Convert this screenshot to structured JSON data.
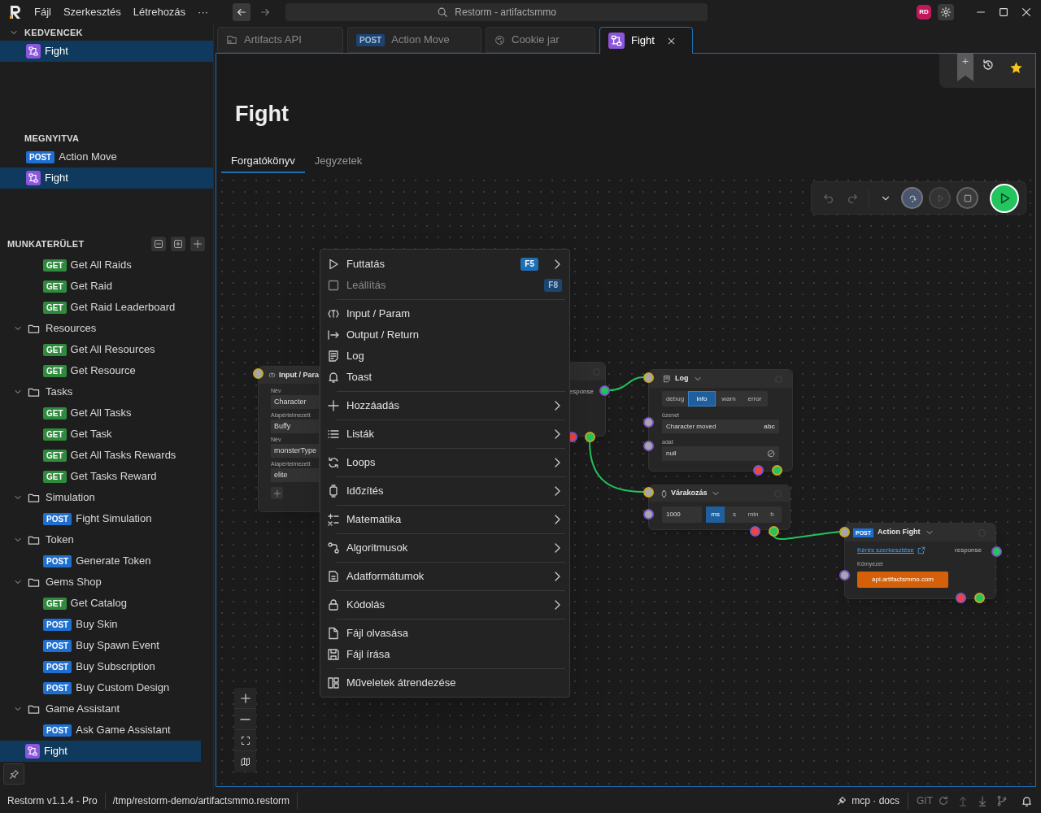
{
  "titlebar": {
    "menu": [
      "Fájl",
      "Szerkesztés",
      "Létrehozás",
      "···"
    ],
    "search": "Restorm - artifactsmmo",
    "avatar": "RD"
  },
  "sidebar": {
    "sections": [
      {
        "title": "KEDVENCEK",
        "expanded": true,
        "items": [
          {
            "kind": "flow",
            "label": "Fight",
            "selected": true
          }
        ]
      },
      {
        "title": "MEGNYITVA",
        "items": [
          {
            "kind": "request",
            "method": "POST",
            "label": "Action Move",
            "selected": false
          },
          {
            "kind": "flow",
            "label": "Fight",
            "selected": true
          }
        ]
      }
    ],
    "workspace": {
      "title": "MUNKATERÜLET",
      "items": [
        {
          "kind": "request",
          "method": "GET",
          "label": "Get All Raids",
          "selected": false
        },
        {
          "kind": "request",
          "method": "GET",
          "label": "Get Raid",
          "selected": false
        },
        {
          "kind": "request",
          "method": "GET",
          "label": "Get Raid Leaderboard",
          "selected": false
        },
        {
          "kind": "folder",
          "label": "Resources",
          "expanded": true,
          "children": [
            {
              "kind": "request",
              "method": "GET",
              "label": "Get All Resources",
              "selected": false
            },
            {
              "kind": "request",
              "method": "GET",
              "label": "Get Resource",
              "selected": false
            }
          ]
        },
        {
          "kind": "folder",
          "label": "Tasks",
          "expanded": true,
          "children": [
            {
              "kind": "request",
              "method": "GET",
              "label": "Get All Tasks",
              "selected": false
            },
            {
              "kind": "request",
              "method": "GET",
              "label": "Get Task",
              "selected": false
            },
            {
              "kind": "request",
              "method": "GET",
              "label": "Get All Tasks Rewards",
              "selected": false
            },
            {
              "kind": "request",
              "method": "GET",
              "label": "Get Tasks Reward",
              "selected": false
            }
          ]
        },
        {
          "kind": "folder",
          "label": "Simulation",
          "expanded": true,
          "children": [
            {
              "kind": "request",
              "method": "POST",
              "label": "Fight Simulation",
              "selected": false
            }
          ]
        },
        {
          "kind": "folder",
          "label": "Token",
          "expanded": true,
          "children": [
            {
              "kind": "request",
              "method": "POST",
              "label": "Generate Token",
              "selected": false
            }
          ]
        },
        {
          "kind": "folder",
          "label": "Gems Shop",
          "expanded": true,
          "children": [
            {
              "kind": "request",
              "method": "GET",
              "label": "Get Catalog",
              "selected": false
            },
            {
              "kind": "request",
              "method": "POST",
              "label": "Buy Skin",
              "selected": false
            },
            {
              "kind": "request",
              "method": "POST",
              "label": "Buy Spawn Event",
              "selected": false
            },
            {
              "kind": "request",
              "method": "POST",
              "label": "Buy Subscription",
              "selected": false
            },
            {
              "kind": "request",
              "method": "POST",
              "label": "Buy Custom Design",
              "selected": false
            }
          ]
        },
        {
          "kind": "folder",
          "label": "Game Assistant",
          "expanded": true,
          "children": [
            {
              "kind": "request",
              "method": "POST",
              "label": "Ask Game Assistant",
              "selected": false
            }
          ]
        },
        {
          "kind": "flow",
          "label": "Fight",
          "selected": true
        }
      ]
    }
  },
  "tabs": [
    {
      "kind": "collection",
      "label": "Artifacts API",
      "selected": false
    },
    {
      "kind": "request",
      "method": "POST",
      "label": "Action Move",
      "selected": false
    },
    {
      "kind": "cookies",
      "label": "Cookie jar",
      "selected": false
    },
    {
      "kind": "flow",
      "label": "Fight",
      "selected": true
    }
  ],
  "page": {
    "title": "Fight",
    "tabs": [
      {
        "label": "Forgatókönyv",
        "selected": true
      },
      {
        "label": "Jegyzetek",
        "selected": false
      }
    ]
  },
  "canvas": {
    "nodes": [
      {
        "kind": "input",
        "title": "Input / Para",
        "params": [
          {
            "name_label": "Név",
            "name": "Character",
            "default_label": "Alapértelmezett",
            "default": "Buffy"
          },
          {
            "name_label": "Név",
            "name": "monsterType",
            "default_label": "Alapértelmezett",
            "default": "elite"
          }
        ]
      },
      {
        "kind": "partial",
        "output": "esponse"
      },
      {
        "kind": "log",
        "title": "Log",
        "levels": [
          {
            "label": "debug",
            "selected": false
          },
          {
            "label": "info",
            "selected": true
          },
          {
            "label": "warn",
            "selected": false
          },
          {
            "label": "error",
            "selected": false
          }
        ],
        "message_label": "üzenet",
        "message": "Character moved",
        "message_type": "abc",
        "data_label": "adat",
        "data": "null"
      },
      {
        "kind": "wait",
        "title": "Várakozás",
        "value": "1000",
        "units": [
          {
            "label": "ms",
            "selected": true
          },
          {
            "label": "s",
            "selected": false
          },
          {
            "label": "min",
            "selected": false
          },
          {
            "label": "h",
            "selected": false
          }
        ]
      },
      {
        "kind": "request",
        "method": "POST",
        "title": "Action Fight",
        "link": "Kérés szerkesztése",
        "output": "response",
        "env_label": "Környezet",
        "env": "api.artifactsmmo.com"
      }
    ]
  },
  "context_menu": {
    "items": [
      {
        "kind": "item",
        "label": "Futtatás",
        "shortcut": "F5",
        "submenu": true,
        "disabled": false
      },
      {
        "kind": "item",
        "label": "Leállítás",
        "shortcut": "F8",
        "disabled": true
      },
      {
        "kind": "separator"
      },
      {
        "kind": "item",
        "label": "Input / Param",
        "disabled": false
      },
      {
        "kind": "item",
        "label": "Output / Return",
        "disabled": false
      },
      {
        "kind": "item",
        "label": "Log",
        "disabled": false
      },
      {
        "kind": "item",
        "label": "Toast",
        "disabled": false
      },
      {
        "kind": "separator"
      },
      {
        "kind": "item",
        "label": "Hozzáadás",
        "submenu": true,
        "disabled": false
      },
      {
        "kind": "separator"
      },
      {
        "kind": "item",
        "label": "Listák",
        "submenu": true,
        "disabled": false
      },
      {
        "kind": "separator"
      },
      {
        "kind": "item",
        "label": "Loops",
        "submenu": true,
        "disabled": false
      },
      {
        "kind": "separator"
      },
      {
        "kind": "item",
        "label": "Időzítés",
        "submenu": true,
        "disabled": false
      },
      {
        "kind": "separator"
      },
      {
        "kind": "item",
        "label": "Matematika",
        "submenu": true,
        "disabled": false
      },
      {
        "kind": "separator"
      },
      {
        "kind": "item",
        "label": "Algoritmusok",
        "submenu": true,
        "disabled": false
      },
      {
        "kind": "separator"
      },
      {
        "kind": "item",
        "label": "Adatformátumok",
        "submenu": true,
        "disabled": false
      },
      {
        "kind": "separator"
      },
      {
        "kind": "item",
        "label": "Kódolás",
        "submenu": true,
        "disabled": false
      },
      {
        "kind": "separator"
      },
      {
        "kind": "item",
        "label": "Fájl olvasása",
        "disabled": false
      },
      {
        "kind": "item",
        "label": "Fájl írása",
        "disabled": false
      },
      {
        "kind": "separator"
      },
      {
        "kind": "item",
        "label": "Műveletek átrendezése",
        "disabled": false
      }
    ]
  },
  "statusbar": {
    "version": "Restorm v1.1.4 - Pro",
    "path": "/tmp/restorm-demo/artifactsmmo.restorm",
    "links": "mcp · docs",
    "git": "GIT"
  }
}
